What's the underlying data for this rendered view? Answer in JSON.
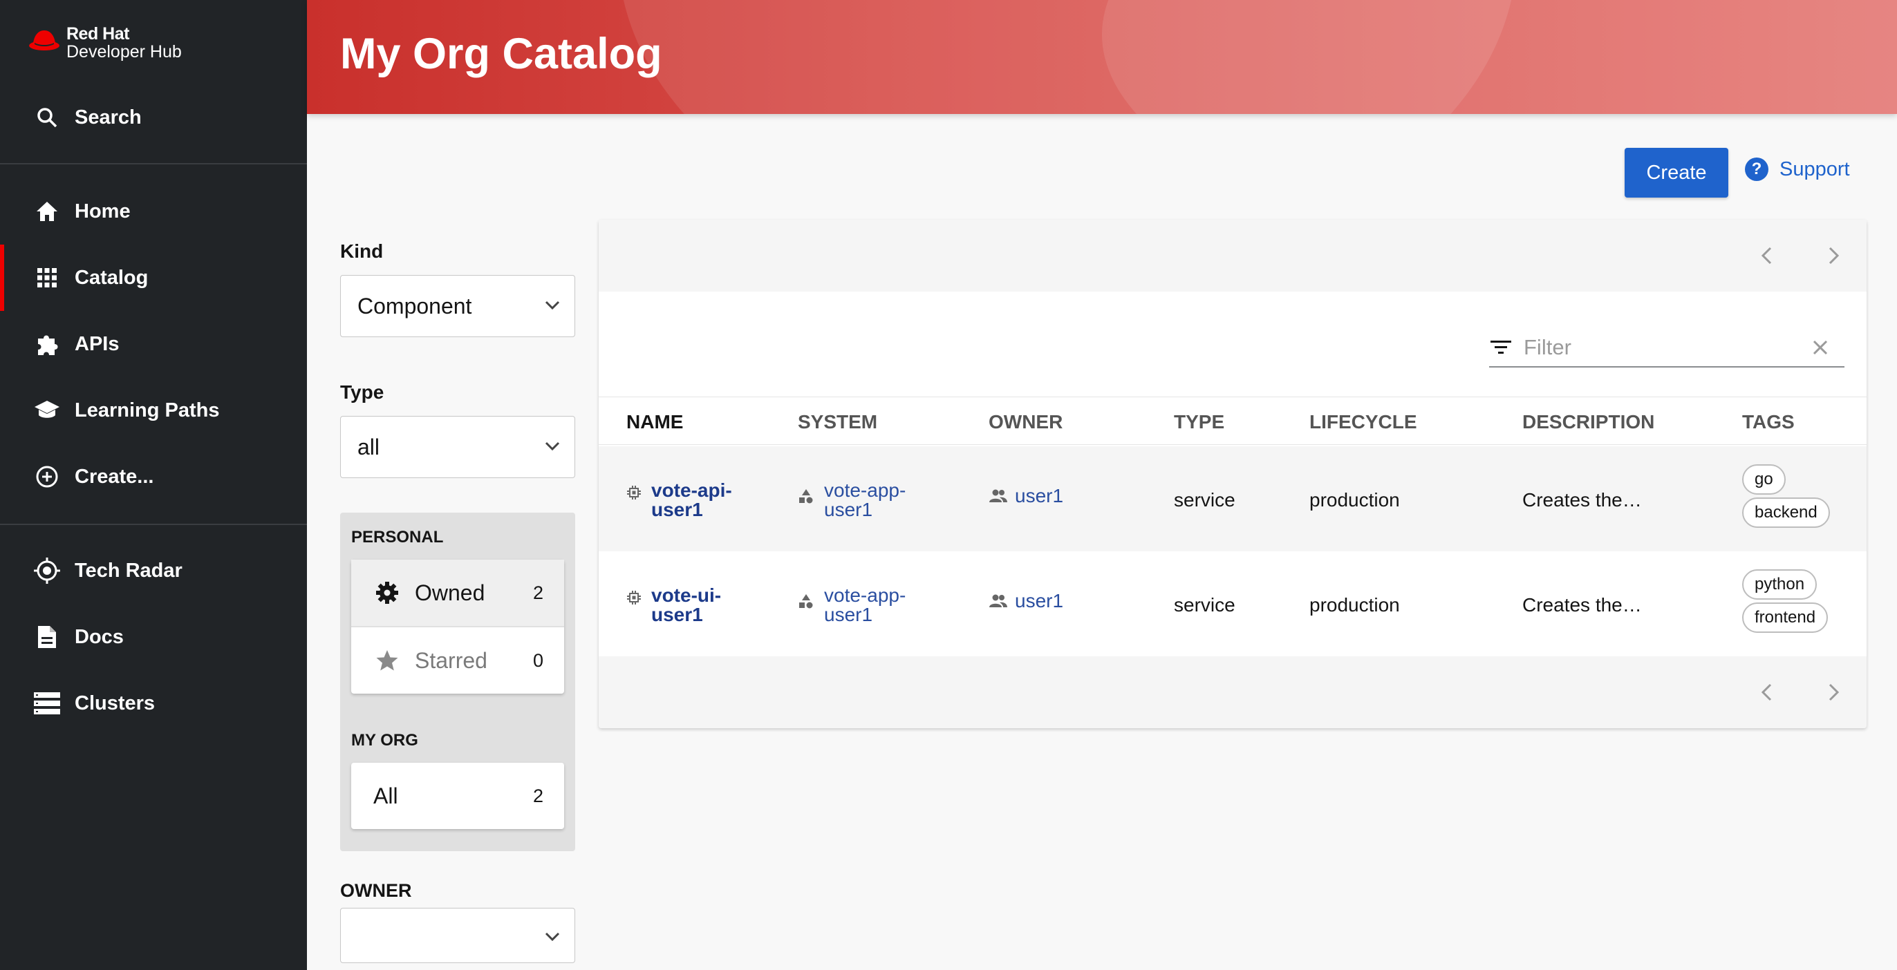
{
  "brand": {
    "line1": "Red Hat",
    "line2": "Developer Hub"
  },
  "sidebar": {
    "search_label": "Search",
    "items": [
      {
        "label": "Home",
        "icon": "home-icon"
      },
      {
        "label": "Catalog",
        "icon": "grid-icon",
        "active": true
      },
      {
        "label": "APIs",
        "icon": "puzzle-icon"
      },
      {
        "label": "Learning Paths",
        "icon": "school-icon"
      },
      {
        "label": "Create...",
        "icon": "add-circle-icon"
      }
    ],
    "tools": [
      {
        "label": "Tech Radar",
        "icon": "radar-icon"
      },
      {
        "label": "Docs",
        "icon": "document-icon"
      },
      {
        "label": "Clusters",
        "icon": "storage-icon"
      }
    ]
  },
  "header": {
    "title": "My Org Catalog"
  },
  "actions": {
    "create_label": "Create",
    "support_label": "Support"
  },
  "filters": {
    "kind_label": "Kind",
    "kind_value": "Component",
    "type_label": "Type",
    "type_value": "all",
    "personal_title": "PERSONAL",
    "owned_label": "Owned",
    "owned_count": "2",
    "starred_label": "Starred",
    "starred_count": "0",
    "myorg_title": "MY ORG",
    "all_label": "All",
    "all_count": "2",
    "owner_label": "OWNER",
    "owner_value": ""
  },
  "table": {
    "filter_placeholder": "Filter",
    "columns": [
      "NAME",
      "SYSTEM",
      "OWNER",
      "TYPE",
      "LIFECYCLE",
      "DESCRIPTION",
      "TAGS"
    ],
    "rows": [
      {
        "name_l1": "vote-api-",
        "name_l2": "user1",
        "system_l1": "vote-app-",
        "system_l2": "user1",
        "owner": "user1",
        "type": "service",
        "lifecycle": "production",
        "description": "Creates the…",
        "tags": [
          "go",
          "backend"
        ]
      },
      {
        "name_l1": "vote-ui-",
        "name_l2": "user1",
        "system_l1": "vote-app-",
        "system_l2": "user1",
        "owner": "user1",
        "type": "service",
        "lifecycle": "production",
        "description": "Creates the…",
        "tags": [
          "python",
          "frontend"
        ]
      }
    ]
  }
}
